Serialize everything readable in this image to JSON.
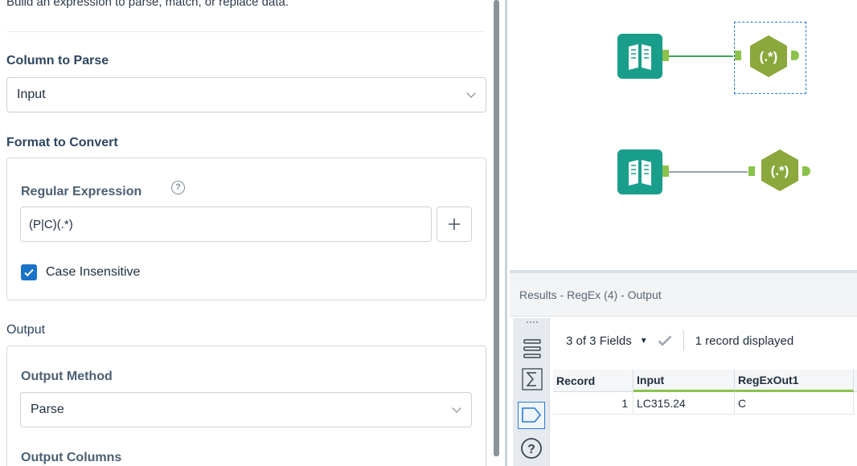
{
  "config": {
    "description": "Build an expression to parse, match, or replace data.",
    "column_to_parse": {
      "label": "Column to Parse",
      "value": "Input"
    },
    "format_to_convert": {
      "label": "Format to Convert",
      "regex_label": "Regular Expression",
      "regex_value": "(P|C)(.*)",
      "case_insensitive": {
        "label": "Case Insensitive",
        "checked": true
      }
    },
    "output": {
      "label": "Output",
      "method_label": "Output Method",
      "method_value": "Parse",
      "columns_label": "Output Columns"
    }
  },
  "canvas": {
    "tools": [
      {
        "type": "input-data-tool",
        "selected": false
      },
      {
        "type": "regex-tool",
        "label": "(.*)",
        "selected": true
      },
      {
        "type": "input-data-tool",
        "selected": false
      },
      {
        "type": "regex-tool",
        "label": "(.*)",
        "selected": false
      }
    ],
    "colors": {
      "input_tool": "#1a9e8c",
      "regex_tool": "#8aa83c",
      "connection_active": "#3fa35b",
      "connection_idle": "#9aa3ac",
      "anchor": "#8bc34a"
    }
  },
  "results": {
    "title": "Results - RegEx (4) - Output",
    "fields_selector": "3 of 3 Fields",
    "records_status": "1 record displayed",
    "columns": [
      "Record",
      "Input",
      "RegExOut1"
    ],
    "rows": [
      {
        "record": "1",
        "input": "LC315.24",
        "regexout1": "C"
      }
    ]
  }
}
